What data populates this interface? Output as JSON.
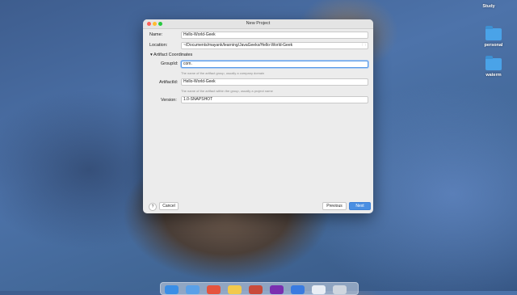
{
  "desktop": {
    "icons": [
      {
        "label": "Study"
      },
      {
        "label": "personal"
      },
      {
        "label": "waterm"
      }
    ]
  },
  "dialog": {
    "title": "New Project",
    "name_label": "Name:",
    "name_value": "Hello-World-Geek",
    "location_label": "Location:",
    "location_value": "~/Documents/mayank/learning/JavaGeeks/Hello-World-Geek",
    "section_toggle": "▾",
    "section_title": "Artifact Coordinates",
    "groupid_label": "GroupId:",
    "groupid_value": "com.",
    "groupid_hint": "The name of the artifact group, usually a company domain",
    "artifactid_label": "ArtifactId:",
    "artifactid_value": "Hello-World-Geek",
    "artifactid_hint": "The name of the artifact within the group, usually a project name",
    "version_label": "Version:",
    "version_value": "1.0-SNAPSHOT",
    "help_label": "?",
    "cancel_label": "Cancel",
    "previous_label": "Previous",
    "next_label": "Next"
  },
  "dock": {
    "apps": [
      {
        "name": "finder",
        "color": "#3a8ee6"
      },
      {
        "name": "app-2",
        "color": "#5aa0e8"
      },
      {
        "name": "calendar",
        "color": "#e5533d"
      },
      {
        "name": "notes",
        "color": "#f2c94c"
      },
      {
        "name": "app-5",
        "color": "#c94b3a"
      },
      {
        "name": "intellij",
        "color": "#7a2fb0"
      },
      {
        "name": "app-7",
        "color": "#3a7be0"
      },
      {
        "name": "app-8",
        "color": "#e9eef5"
      },
      {
        "name": "trash",
        "color": "#cfd6df"
      }
    ]
  }
}
